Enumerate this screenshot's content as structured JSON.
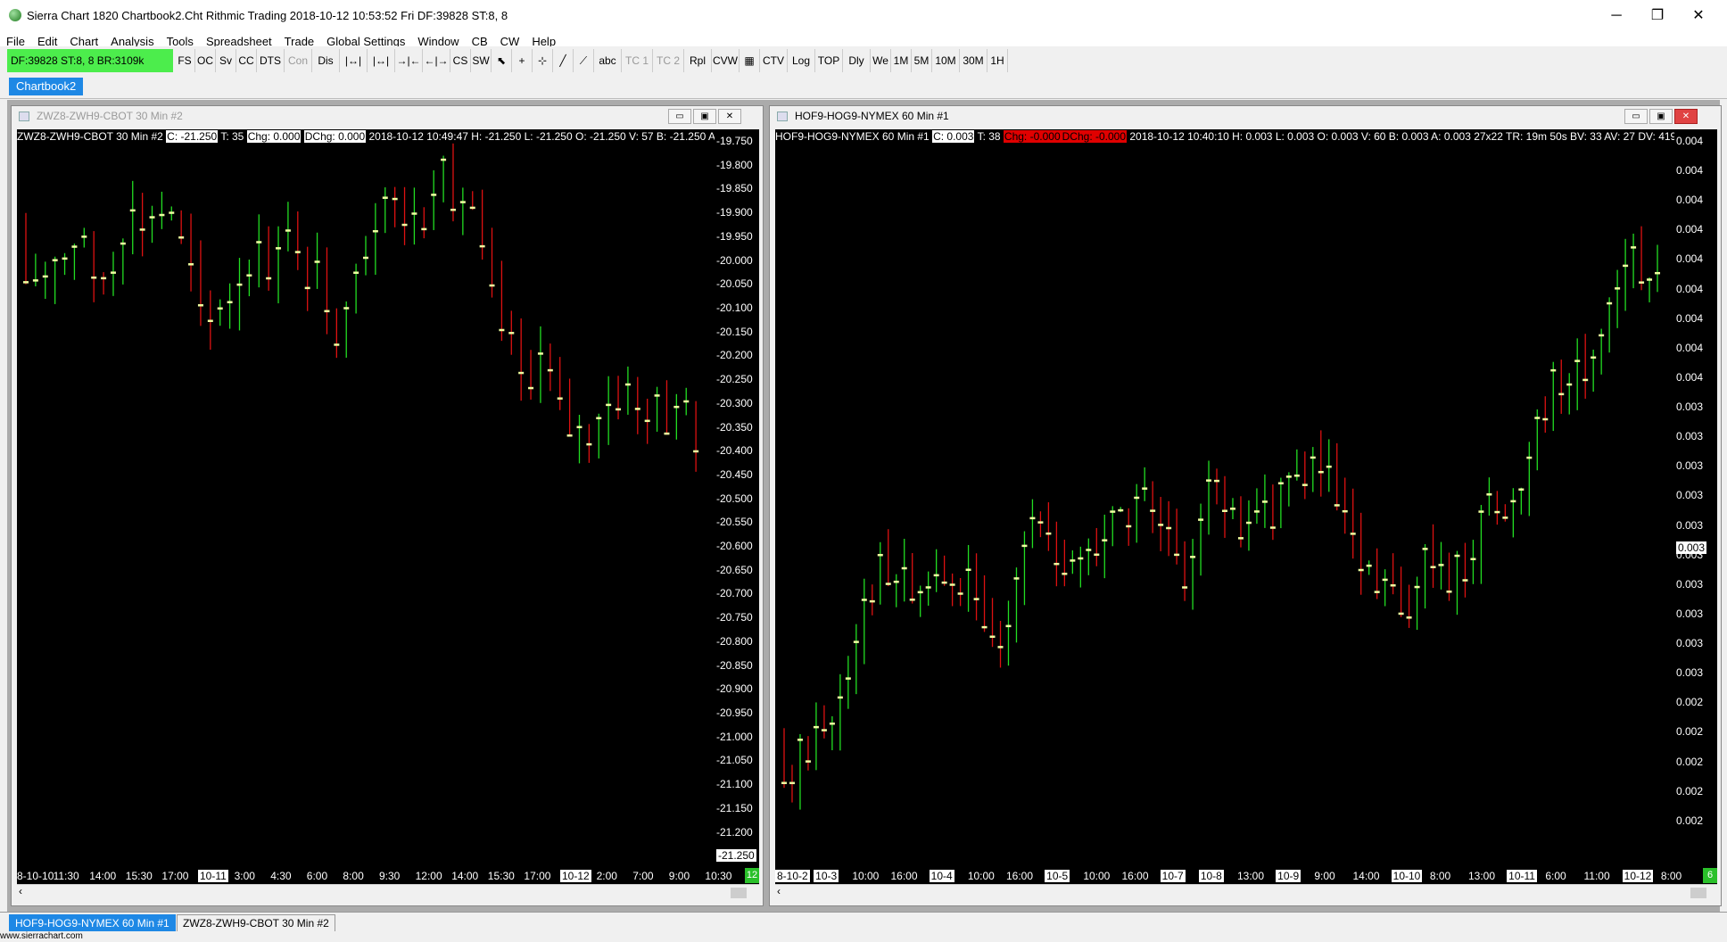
{
  "app": {
    "title": "Sierra Chart 1820 Chartbook2.Cht  Rithmic Trading 2018-10-12  10:53:52 Fri  DF:39828  ST:8, 8"
  },
  "window_controls": [
    "─",
    "❐",
    "✕"
  ],
  "menu": [
    "File",
    "Edit",
    "Chart",
    "Analysis",
    "Tools",
    "Spreadsheet",
    "Trade",
    "Global Settings",
    "Window",
    "CB",
    "CW",
    "Help"
  ],
  "status_box": "DF:39828  ST:8, 8  BR:3109k",
  "toolbar": [
    {
      "label": "FS",
      "dis": false
    },
    {
      "label": "OC",
      "dis": false
    },
    {
      "label": "Sv",
      "dis": false
    },
    {
      "label": "CC",
      "dis": false
    },
    {
      "label": "DTS",
      "dis": false
    },
    {
      "label": "Con",
      "dis": true
    },
    {
      "label": "Dis",
      "dis": false
    },
    {
      "label": "|↔|",
      "dis": false
    },
    {
      "label": "|↔|",
      "dis": false
    },
    {
      "label": "→|←",
      "dis": false
    },
    {
      "label": "←|→",
      "dis": false
    },
    {
      "label": "CS",
      "dis": false
    },
    {
      "label": "SW",
      "dis": false
    },
    {
      "label": "⬉",
      "dis": false
    },
    {
      "label": "+",
      "dis": false
    },
    {
      "label": "⊹",
      "dis": false
    },
    {
      "label": "╱",
      "dis": false
    },
    {
      "label": "⟋",
      "dis": false
    },
    {
      "label": "abc",
      "dis": false
    },
    {
      "label": "TC 1",
      "dis": true
    },
    {
      "label": "TC 2",
      "dis": true
    },
    {
      "label": "Rpl",
      "dis": false
    },
    {
      "label": "CVW",
      "dis": false
    },
    {
      "label": "▦",
      "dis": false
    },
    {
      "label": "CTV",
      "dis": false
    },
    {
      "label": "Log",
      "dis": false
    },
    {
      "label": "TOP",
      "dis": false
    },
    {
      "label": "Dly",
      "dis": false
    },
    {
      "label": "We",
      "dis": false
    },
    {
      "label": "1M",
      "dis": false
    },
    {
      "label": "5M",
      "dis": false
    },
    {
      "label": "10M",
      "dis": false
    },
    {
      "label": "30M",
      "dis": false
    },
    {
      "label": "1H",
      "dis": false
    }
  ],
  "chartbook_tab": "Chartbook2",
  "left_chart": {
    "title": "ZWZ8-ZWH9-CBOT  30 Min   #2",
    "info_prefix": "ZWZ8-ZWH9-CBOT  30 Min   #2",
    "info_close": "C: -21.250",
    "info_t": "T: 35",
    "info_chg": "Chg: 0.000",
    "info_dchg": "DChg: 0.000",
    "info_rest": "2018-10-12 10:49:47 H: -21.250 L: -21.250 O: -21.250 V: 57 B: -21.250 A: -21.0",
    "y_labels": [
      "-19.750",
      "-19.800",
      "-19.850",
      "-19.900",
      "-19.950",
      "-20.000",
      "-20.050",
      "-20.100",
      "-20.150",
      "-20.200",
      "-20.250",
      "-20.300",
      "-20.350",
      "-20.400",
      "-20.450",
      "-20.500",
      "-20.550",
      "-20.600",
      "-20.650",
      "-20.700",
      "-20.750",
      "-20.800",
      "-20.850",
      "-20.900",
      "-20.950",
      "-21.000",
      "-21.050",
      "-21.100",
      "-21.150",
      "-21.200"
    ],
    "current_price": "-21.250",
    "x_labels": [
      {
        "t": "8-10-10",
        "day": false
      },
      {
        "t": "11:30",
        "day": false
      },
      {
        "t": "14:00",
        "day": false
      },
      {
        "t": "15:30",
        "day": false
      },
      {
        "t": "17:00",
        "day": false
      },
      {
        "t": "10-11",
        "day": true
      },
      {
        "t": "3:00",
        "day": false
      },
      {
        "t": "4:30",
        "day": false
      },
      {
        "t": "6:00",
        "day": false
      },
      {
        "t": "8:00",
        "day": false
      },
      {
        "t": "9:30",
        "day": false
      },
      {
        "t": "12:00",
        "day": false
      },
      {
        "t": "14:00",
        "day": false
      },
      {
        "t": "15:30",
        "day": false
      },
      {
        "t": "17:00",
        "day": false
      },
      {
        "t": "10-12",
        "day": true
      },
      {
        "t": "2:00",
        "day": false
      },
      {
        "t": "7:00",
        "day": false
      },
      {
        "t": "9:00",
        "day": false
      },
      {
        "t": "10:30",
        "day": false
      }
    ],
    "bar_count": "12"
  },
  "right_chart": {
    "title": "HOF9-HOG9-NYMEX  60 Min   #1",
    "info_prefix": "HOF9-HOG9-NYMEX  60 Min   #1",
    "info_close": "C: 0.003",
    "info_t": "T: 38",
    "info_chg": "Chg: -0.000",
    "info_dchg": "DChg: -0.000",
    "info_rest": "2018-10-12 10:40:10 H: 0.003 L: 0.003 O: 0.003 V: 60 B: 0.003 A: 0.003 27x22 TR: 19m 50s BV: 33 AV: 27 DV: 419",
    "y_labels": [
      "0.004",
      "0.004",
      "0.004",
      "0.004",
      "0.004",
      "0.004",
      "0.004",
      "0.004",
      "0.004",
      "0.003",
      "0.003",
      "0.003",
      "0.003",
      "0.003",
      "0.003",
      "0.003",
      "0.003",
      "0.003",
      "0.003",
      "0.002",
      "0.002",
      "0.002",
      "0.002",
      "0.002"
    ],
    "current_price": "0.003",
    "x_labels": [
      {
        "t": "8-10-2",
        "day": true
      },
      {
        "t": "10-3",
        "day": true
      },
      {
        "t": "10:00",
        "day": false
      },
      {
        "t": "16:00",
        "day": false
      },
      {
        "t": "10-4",
        "day": true
      },
      {
        "t": "10:00",
        "day": false
      },
      {
        "t": "16:00",
        "day": false
      },
      {
        "t": "10-5",
        "day": true
      },
      {
        "t": "10:00",
        "day": false
      },
      {
        "t": "16:00",
        "day": false
      },
      {
        "t": "10-7",
        "day": true
      },
      {
        "t": "10-8",
        "day": true
      },
      {
        "t": "13:00",
        "day": false
      },
      {
        "t": "10-9",
        "day": true
      },
      {
        "t": "9:00",
        "day": false
      },
      {
        "t": "14:00",
        "day": false
      },
      {
        "t": "10-10",
        "day": true
      },
      {
        "t": "8:00",
        "day": false
      },
      {
        "t": "13:00",
        "day": false
      },
      {
        "t": "10-11",
        "day": true
      },
      {
        "t": "6:00",
        "day": false
      },
      {
        "t": "11:00",
        "day": false
      },
      {
        "t": "10-12",
        "day": true
      },
      {
        "t": "8:00",
        "day": false
      }
    ],
    "bar_count": "6"
  },
  "bottom_tabs": [
    "HOF9-HOG9-NYMEX  60 Min   #1",
    "ZWZ8-ZWH9-CBOT  30 Min   #2"
  ],
  "status_url": "www.sierrachart.com",
  "colors": {
    "up": "#22dd22",
    "down": "#dd1111",
    "tick": "#f0ffa0",
    "accent": "#1e88e5",
    "status": "#4ced4c"
  }
}
